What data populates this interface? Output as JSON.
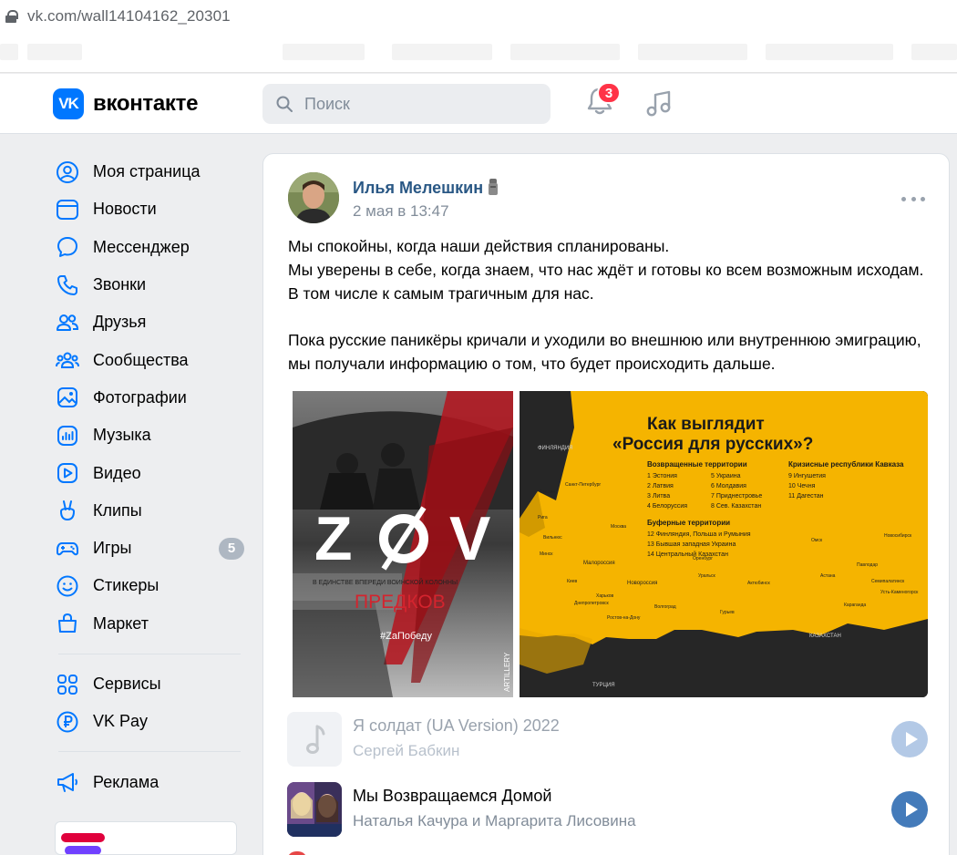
{
  "browser": {
    "url": "vk.com/wall14104162_20301"
  },
  "header": {
    "logo_text": "вконтакте",
    "logo_mark": "VK",
    "search_placeholder": "Поиск",
    "notifications_count": "3"
  },
  "sidebar": {
    "items": [
      {
        "label": "Моя страница",
        "icon": "user-circle-icon"
      },
      {
        "label": "Новости",
        "icon": "news-icon"
      },
      {
        "label": "Мессенджер",
        "icon": "message-icon"
      },
      {
        "label": "Звонки",
        "icon": "phone-icon"
      },
      {
        "label": "Друзья",
        "icon": "friends-icon"
      },
      {
        "label": "Сообщества",
        "icon": "communities-icon"
      },
      {
        "label": "Фотографии",
        "icon": "photo-icon"
      },
      {
        "label": "Музыка",
        "icon": "music-icon"
      },
      {
        "label": "Видео",
        "icon": "video-icon"
      },
      {
        "label": "Клипы",
        "icon": "clips-icon"
      },
      {
        "label": "Игры",
        "icon": "gamepad-icon",
        "count": "5"
      },
      {
        "label": "Стикеры",
        "icon": "sticker-icon"
      },
      {
        "label": "Маркет",
        "icon": "market-bag-icon"
      }
    ],
    "items2": [
      {
        "label": "Сервисы",
        "icon": "services-grid-icon"
      },
      {
        "label": "VK Pay",
        "icon": "ruble-icon"
      }
    ],
    "items3": [
      {
        "label": "Реклама",
        "icon": "megaphone-icon"
      }
    ]
  },
  "post": {
    "author": "Илья Мелешкин",
    "date": "2 мая в 13:47",
    "text_lines": [
      "Мы спокойны, когда наши действия спланированы.",
      "Мы уверены в себе, когда знаем, что нас ждёт и готовы ко всем возможным исходам. В том числе к самым трагичным для нас.",
      "Пока русские паникёры кричали и уходили во внешнюю или внутреннюю эмиграцию, мы получали информацию о том, что будет происходить дальше."
    ],
    "image1": {
      "big_text": "Z",
      "big_text2": "V",
      "sub_text": "ПРЕДКОВ",
      "hashtag": "#ZaПобеду",
      "sign": "В ЕДИНСТВЕ ВПЕРЕДИ ВОИНСКОЙ КОЛОННЫ",
      "vertical": "ARTILLERY"
    },
    "image2": {
      "title_line1": "Как выглядит",
      "title_line2": "«Россия для русских»?",
      "col1_title": "Возвращенные территории",
      "col1_items": [
        "1  Эстония",
        "2  Латвия",
        "3  Литва",
        "4  Белоруссия"
      ],
      "col1b_items": [
        "5  Украина",
        "6  Молдавия",
        "7  Приднестровье",
        "8  Сев. Казахстан"
      ],
      "col2_title": "Кризисные республики Кавказа",
      "col2_items": [
        "9  Ингушетия",
        "10  Чечня",
        "11  Дагестан"
      ],
      "buffer_title": "Буферные территории",
      "buffer_items": [
        "12  Финляндия, Польша и Румыния",
        "13  Бывшая западная Украина",
        "14  Центральный Казахстан"
      ],
      "cities": [
        "Санкт-Петербург",
        "Москва",
        "Минск",
        "Киев",
        "Новороссия",
        "Малороссия",
        "Волгоград",
        "Оренбург",
        "Новосибирск",
        "Омск",
        "Павлодар",
        "Семипалатинск",
        "Усть-Каменогорск",
        "Актюбинск",
        "Уральск",
        "Астана",
        "Ростов-на-Дону",
        "Днепропетровск",
        "Харьков",
        "Рига",
        "Вильнюс",
        "Таллин",
        "Гурьев",
        "Караганда"
      ],
      "labels": [
        "ФИНЛЯНДИЯ",
        "ТУРЦИЯ",
        "КАЗАХСТАН"
      ]
    }
  },
  "tracks": [
    {
      "title": "Я солдат (UA Version) 2022",
      "artist": "Сергей Бабкин",
      "disabled": true
    },
    {
      "title": "Мы Возвращаемся Домой",
      "artist": "Наталья Качура и Маргарита Лисовина",
      "disabled": false
    }
  ],
  "colors": {
    "vk_blue": "#0077ff",
    "link": "#2a5885",
    "badge_red": "#ff3347",
    "map_yellow": "#f5b400"
  }
}
